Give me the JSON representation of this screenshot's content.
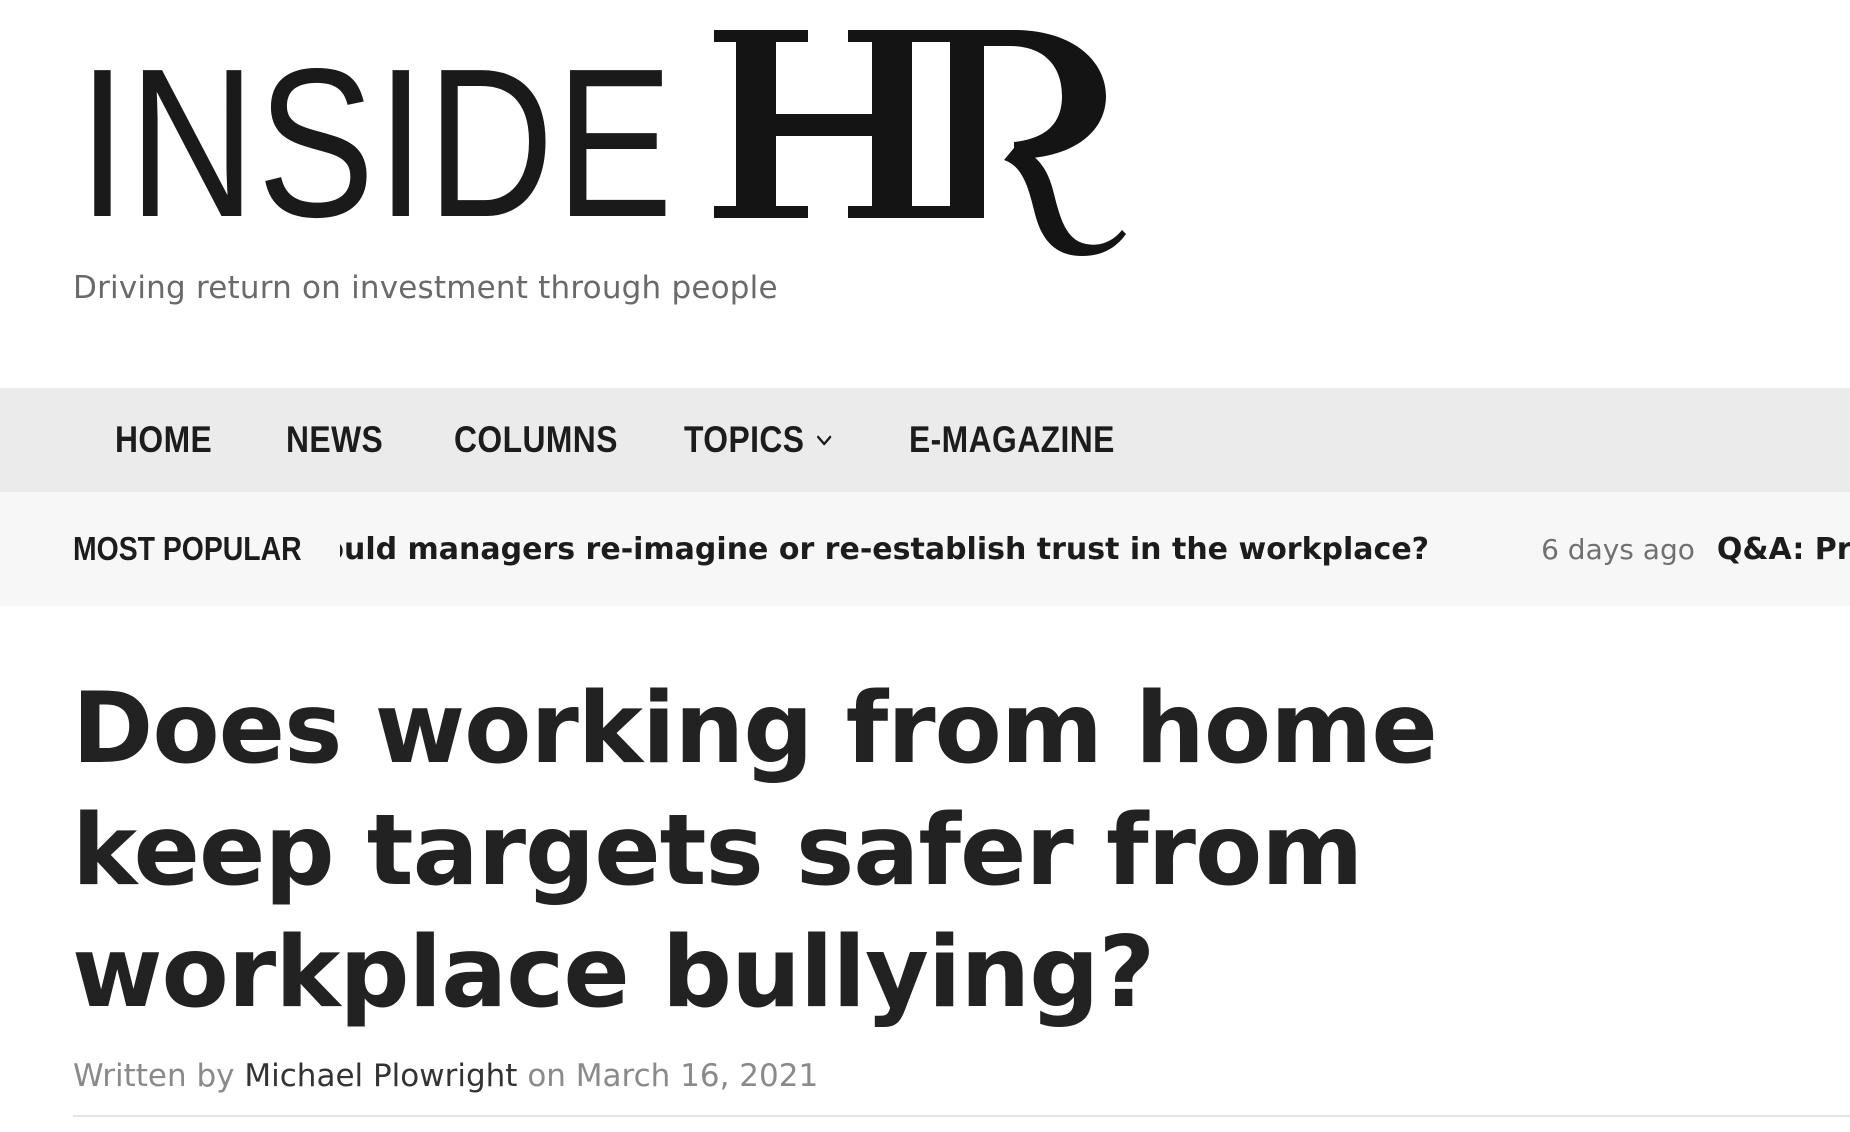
{
  "site": {
    "logo_text_light": "INSIDE",
    "logo_text_bold": "HR",
    "tagline": "Driving return on investment through people"
  },
  "nav": {
    "items": [
      {
        "label": "HOME"
      },
      {
        "label": "NEWS"
      },
      {
        "label": "COLUMNS"
      },
      {
        "label": "TOPICS",
        "has_dropdown": true
      },
      {
        "label": "E-MAGAZINE"
      }
    ]
  },
  "ticker": {
    "label": "MOST POPULAR",
    "items": [
      {
        "headline": "hould managers re-imagine or re-establish trust in the workplace?",
        "time": "6 days ago"
      },
      {
        "headline": "Q&A: Providing"
      }
    ]
  },
  "article": {
    "title": "Does working from home keep targets safer from workplace bullying?",
    "byline_prefix": "Written by",
    "author": "Michael Plowright",
    "byline_on": "on",
    "date": "March 16, 2021"
  },
  "colors": {
    "nav_background": "#ebebeb",
    "ticker_background": "#f7f7f7",
    "title_text": "#222222",
    "muted_text": "#8a8a8a"
  }
}
